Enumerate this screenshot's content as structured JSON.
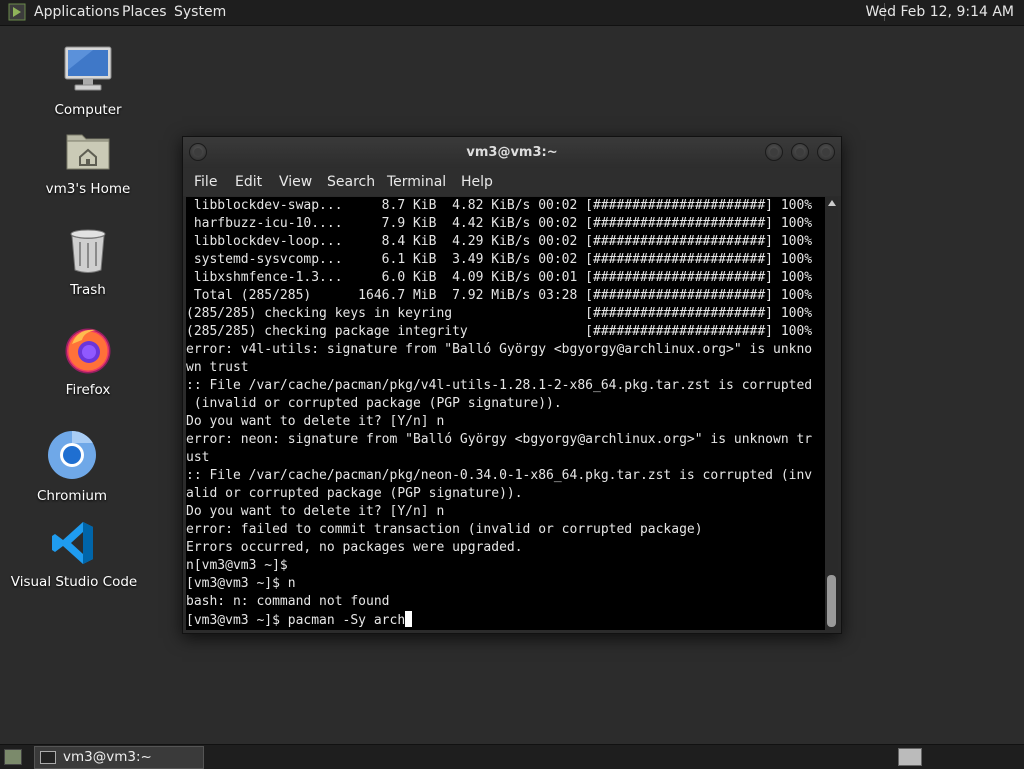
{
  "top_panel": {
    "applications": "Applications",
    "places": "Places",
    "system": "System",
    "clock": "Wed Feb 12,  9:14 AM"
  },
  "desktop": {
    "icons": [
      {
        "label": "Computer",
        "icon": "computer-icon"
      },
      {
        "label": "vm3's Home",
        "icon": "home-folder-icon"
      },
      {
        "label": "Trash",
        "icon": "trash-icon"
      },
      {
        "label": "Firefox",
        "icon": "firefox-icon"
      },
      {
        "label": "Chromium",
        "icon": "chromium-icon"
      },
      {
        "label": "Visual Studio Code",
        "icon": "vscode-icon"
      }
    ]
  },
  "terminal": {
    "title": "vm3@vm3:~",
    "menu": [
      "File",
      "Edit",
      "View",
      "Search",
      "Terminal",
      "Help"
    ],
    "lines": [
      " libblockdev-swap...     8.7 KiB  4.82 KiB/s 00:02 [######################] 100%",
      " harfbuzz-icu-10....     7.9 KiB  4.42 KiB/s 00:02 [######################] 100%",
      " libblockdev-loop...     8.4 KiB  4.29 KiB/s 00:02 [######################] 100%",
      " systemd-sysvcomp...     6.1 KiB  3.49 KiB/s 00:02 [######################] 100%",
      " libxshmfence-1.3...     6.0 KiB  4.09 KiB/s 00:01 [######################] 100%",
      " Total (285/285)      1646.7 MiB  7.92 MiB/s 03:28 [######################] 100%",
      "(285/285) checking keys in keyring                 [######################] 100%",
      "(285/285) checking package integrity               [######################] 100%",
      "error: v4l-utils: signature from \"Balló György <bgyorgy@archlinux.org>\" is unkno",
      "wn trust",
      ":: File /var/cache/pacman/pkg/v4l-utils-1.28.1-2-x86_64.pkg.tar.zst is corrupted",
      " (invalid or corrupted package (PGP signature)).",
      "Do you want to delete it? [Y/n] n",
      "error: neon: signature from \"Balló György <bgyorgy@archlinux.org>\" is unknown tr",
      "ust",
      ":: File /var/cache/pacman/pkg/neon-0.34.0-1-x86_64.pkg.tar.zst is corrupted (inv",
      "alid or corrupted package (PGP signature)).",
      "Do you want to delete it? [Y/n] n",
      "error: failed to commit transaction (invalid or corrupted package)",
      "Errors occurred, no packages were upgraded.",
      "n[vm3@vm3 ~]$",
      "[vm3@vm3 ~]$ n",
      "bash: n: command not found"
    ],
    "prompt_line": "[vm3@vm3 ~]$ pacman -Sy arch"
  },
  "taskbar": {
    "window_label": "vm3@vm3:~"
  }
}
